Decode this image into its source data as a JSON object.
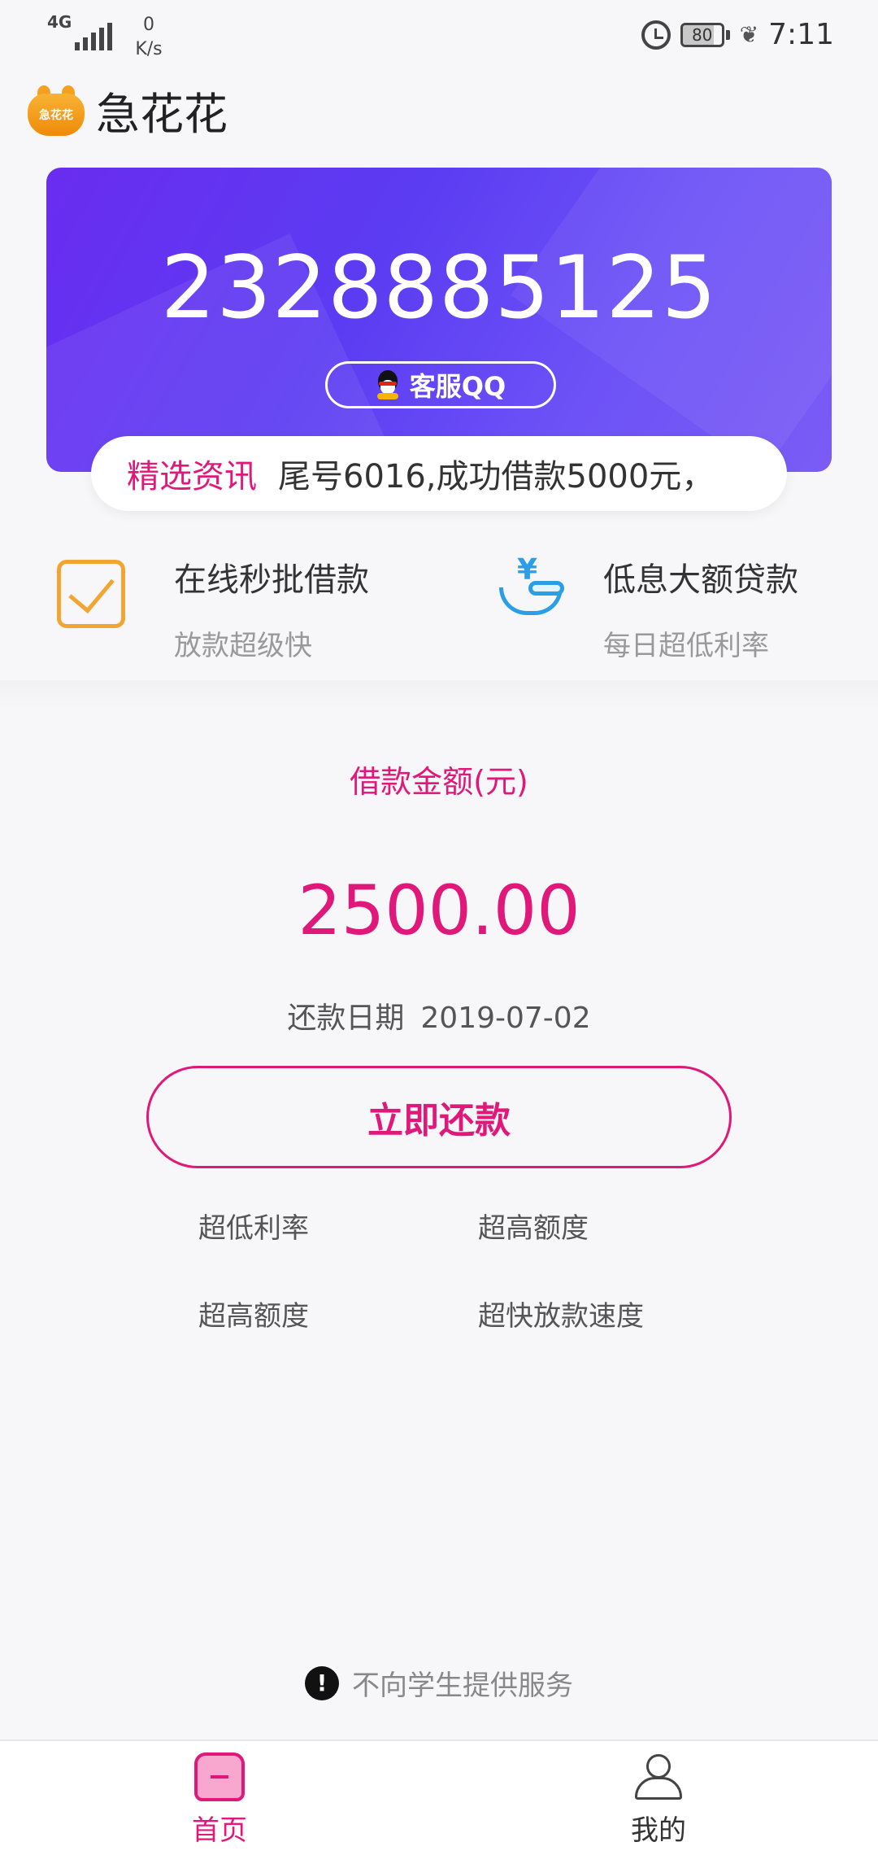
{
  "status_bar": {
    "network": "4G",
    "speed_value": "0",
    "speed_unit": "K/s",
    "battery": "80",
    "battery_level": 0.8,
    "time": "7:11"
  },
  "app": {
    "logo_text": "急花花",
    "title": "急花花"
  },
  "banner": {
    "service_number": "2328885125",
    "qq_button_label": "客服QQ"
  },
  "news": {
    "label": "精选资讯",
    "text": "尾号6016,成功借款5000元，"
  },
  "features": [
    {
      "title": "在线秒批借款",
      "subtitle": "放款超级快",
      "icon": "checkbox-icon"
    },
    {
      "title": "低息大额贷款",
      "subtitle": "每日超低利率",
      "icon": "yen-hand-icon"
    }
  ],
  "loan": {
    "amount_label": "借款金额(元)",
    "amount": "2500.00",
    "repay_date_label": "还款日期",
    "repay_date": "2019-07-02",
    "repay_button_label": "立即还款"
  },
  "perks": [
    "超低利率",
    "超高额度",
    "超高额度",
    "超快放款速度"
  ],
  "notice": {
    "icon_text": "!",
    "text": "不向学生提供服务"
  },
  "tabs": [
    {
      "label": "首页",
      "active": true
    },
    {
      "label": "我的",
      "active": false
    }
  ],
  "colors": {
    "accent": "#e0187a",
    "banner": "#5b3cf2",
    "check": "#f2a531",
    "blue_icon": "#2a9fe8"
  }
}
